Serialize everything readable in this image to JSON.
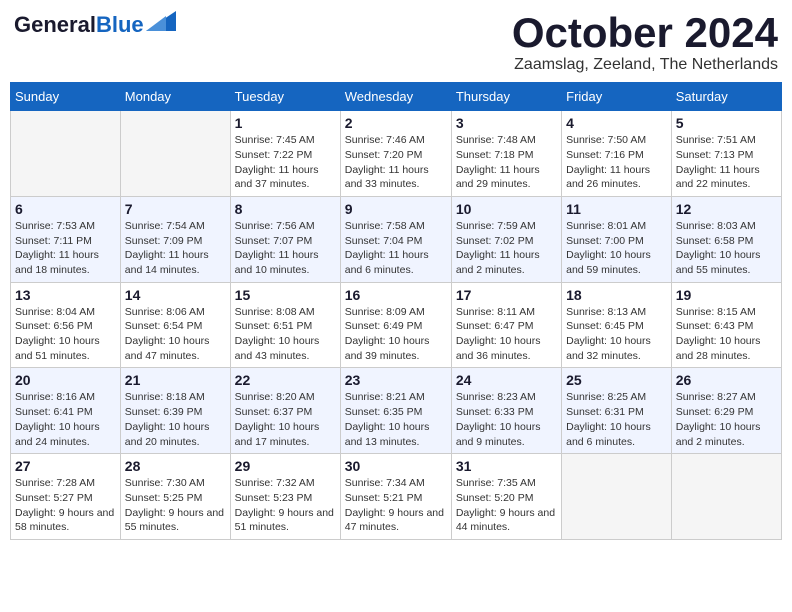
{
  "header": {
    "logo_general": "General",
    "logo_blue": "Blue",
    "month_title": "October 2024",
    "location": "Zaamslag, Zeeland, The Netherlands"
  },
  "days_of_week": [
    "Sunday",
    "Monday",
    "Tuesday",
    "Wednesday",
    "Thursday",
    "Friday",
    "Saturday"
  ],
  "weeks": [
    [
      {
        "day": "",
        "info": ""
      },
      {
        "day": "",
        "info": ""
      },
      {
        "day": "1",
        "info": "Sunrise: 7:45 AM\nSunset: 7:22 PM\nDaylight: 11 hours and 37 minutes."
      },
      {
        "day": "2",
        "info": "Sunrise: 7:46 AM\nSunset: 7:20 PM\nDaylight: 11 hours and 33 minutes."
      },
      {
        "day": "3",
        "info": "Sunrise: 7:48 AM\nSunset: 7:18 PM\nDaylight: 11 hours and 29 minutes."
      },
      {
        "day": "4",
        "info": "Sunrise: 7:50 AM\nSunset: 7:16 PM\nDaylight: 11 hours and 26 minutes."
      },
      {
        "day": "5",
        "info": "Sunrise: 7:51 AM\nSunset: 7:13 PM\nDaylight: 11 hours and 22 minutes."
      }
    ],
    [
      {
        "day": "6",
        "info": "Sunrise: 7:53 AM\nSunset: 7:11 PM\nDaylight: 11 hours and 18 minutes."
      },
      {
        "day": "7",
        "info": "Sunrise: 7:54 AM\nSunset: 7:09 PM\nDaylight: 11 hours and 14 minutes."
      },
      {
        "day": "8",
        "info": "Sunrise: 7:56 AM\nSunset: 7:07 PM\nDaylight: 11 hours and 10 minutes."
      },
      {
        "day": "9",
        "info": "Sunrise: 7:58 AM\nSunset: 7:04 PM\nDaylight: 11 hours and 6 minutes."
      },
      {
        "day": "10",
        "info": "Sunrise: 7:59 AM\nSunset: 7:02 PM\nDaylight: 11 hours and 2 minutes."
      },
      {
        "day": "11",
        "info": "Sunrise: 8:01 AM\nSunset: 7:00 PM\nDaylight: 10 hours and 59 minutes."
      },
      {
        "day": "12",
        "info": "Sunrise: 8:03 AM\nSunset: 6:58 PM\nDaylight: 10 hours and 55 minutes."
      }
    ],
    [
      {
        "day": "13",
        "info": "Sunrise: 8:04 AM\nSunset: 6:56 PM\nDaylight: 10 hours and 51 minutes."
      },
      {
        "day": "14",
        "info": "Sunrise: 8:06 AM\nSunset: 6:54 PM\nDaylight: 10 hours and 47 minutes."
      },
      {
        "day": "15",
        "info": "Sunrise: 8:08 AM\nSunset: 6:51 PM\nDaylight: 10 hours and 43 minutes."
      },
      {
        "day": "16",
        "info": "Sunrise: 8:09 AM\nSunset: 6:49 PM\nDaylight: 10 hours and 39 minutes."
      },
      {
        "day": "17",
        "info": "Sunrise: 8:11 AM\nSunset: 6:47 PM\nDaylight: 10 hours and 36 minutes."
      },
      {
        "day": "18",
        "info": "Sunrise: 8:13 AM\nSunset: 6:45 PM\nDaylight: 10 hours and 32 minutes."
      },
      {
        "day": "19",
        "info": "Sunrise: 8:15 AM\nSunset: 6:43 PM\nDaylight: 10 hours and 28 minutes."
      }
    ],
    [
      {
        "day": "20",
        "info": "Sunrise: 8:16 AM\nSunset: 6:41 PM\nDaylight: 10 hours and 24 minutes."
      },
      {
        "day": "21",
        "info": "Sunrise: 8:18 AM\nSunset: 6:39 PM\nDaylight: 10 hours and 20 minutes."
      },
      {
        "day": "22",
        "info": "Sunrise: 8:20 AM\nSunset: 6:37 PM\nDaylight: 10 hours and 17 minutes."
      },
      {
        "day": "23",
        "info": "Sunrise: 8:21 AM\nSunset: 6:35 PM\nDaylight: 10 hours and 13 minutes."
      },
      {
        "day": "24",
        "info": "Sunrise: 8:23 AM\nSunset: 6:33 PM\nDaylight: 10 hours and 9 minutes."
      },
      {
        "day": "25",
        "info": "Sunrise: 8:25 AM\nSunset: 6:31 PM\nDaylight: 10 hours and 6 minutes."
      },
      {
        "day": "26",
        "info": "Sunrise: 8:27 AM\nSunset: 6:29 PM\nDaylight: 10 hours and 2 minutes."
      }
    ],
    [
      {
        "day": "27",
        "info": "Sunrise: 7:28 AM\nSunset: 5:27 PM\nDaylight: 9 hours and 58 minutes."
      },
      {
        "day": "28",
        "info": "Sunrise: 7:30 AM\nSunset: 5:25 PM\nDaylight: 9 hours and 55 minutes."
      },
      {
        "day": "29",
        "info": "Sunrise: 7:32 AM\nSunset: 5:23 PM\nDaylight: 9 hours and 51 minutes."
      },
      {
        "day": "30",
        "info": "Sunrise: 7:34 AM\nSunset: 5:21 PM\nDaylight: 9 hours and 47 minutes."
      },
      {
        "day": "31",
        "info": "Sunrise: 7:35 AM\nSunset: 5:20 PM\nDaylight: 9 hours and 44 minutes."
      },
      {
        "day": "",
        "info": ""
      },
      {
        "day": "",
        "info": ""
      }
    ]
  ]
}
